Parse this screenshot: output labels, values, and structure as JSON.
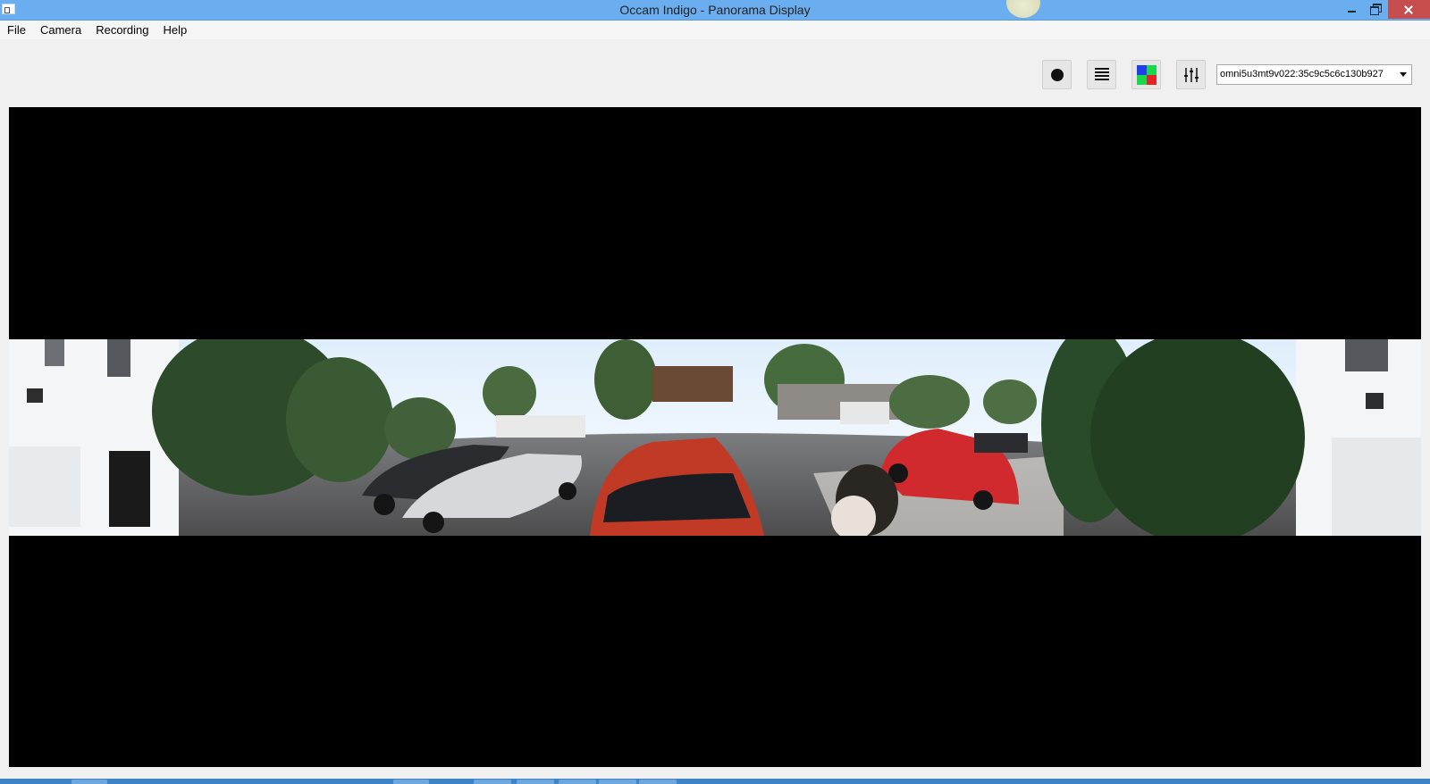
{
  "window": {
    "title": "Occam Indigo - Panorama Display"
  },
  "menubar": {
    "items": [
      {
        "label": "File"
      },
      {
        "label": "Camera"
      },
      {
        "label": "Recording"
      },
      {
        "label": "Help"
      }
    ]
  },
  "toolbar": {
    "record_icon": "record-icon",
    "list_icon": "list-icon",
    "color_icon": "color-grid-icon",
    "adjust_icon": "sliders-icon",
    "color_quadrants": [
      "#1e3ff0",
      "#19d94a",
      "#19d94a",
      "#e8202a"
    ],
    "camera_select": {
      "value": "omni5u3mt9v022:35c9c5c6c130b927"
    }
  },
  "colors": {
    "titlebar": "#6aaef0",
    "close_button": "#c74e4e",
    "display_background": "#000000",
    "taskbar": "#3d84c7"
  }
}
